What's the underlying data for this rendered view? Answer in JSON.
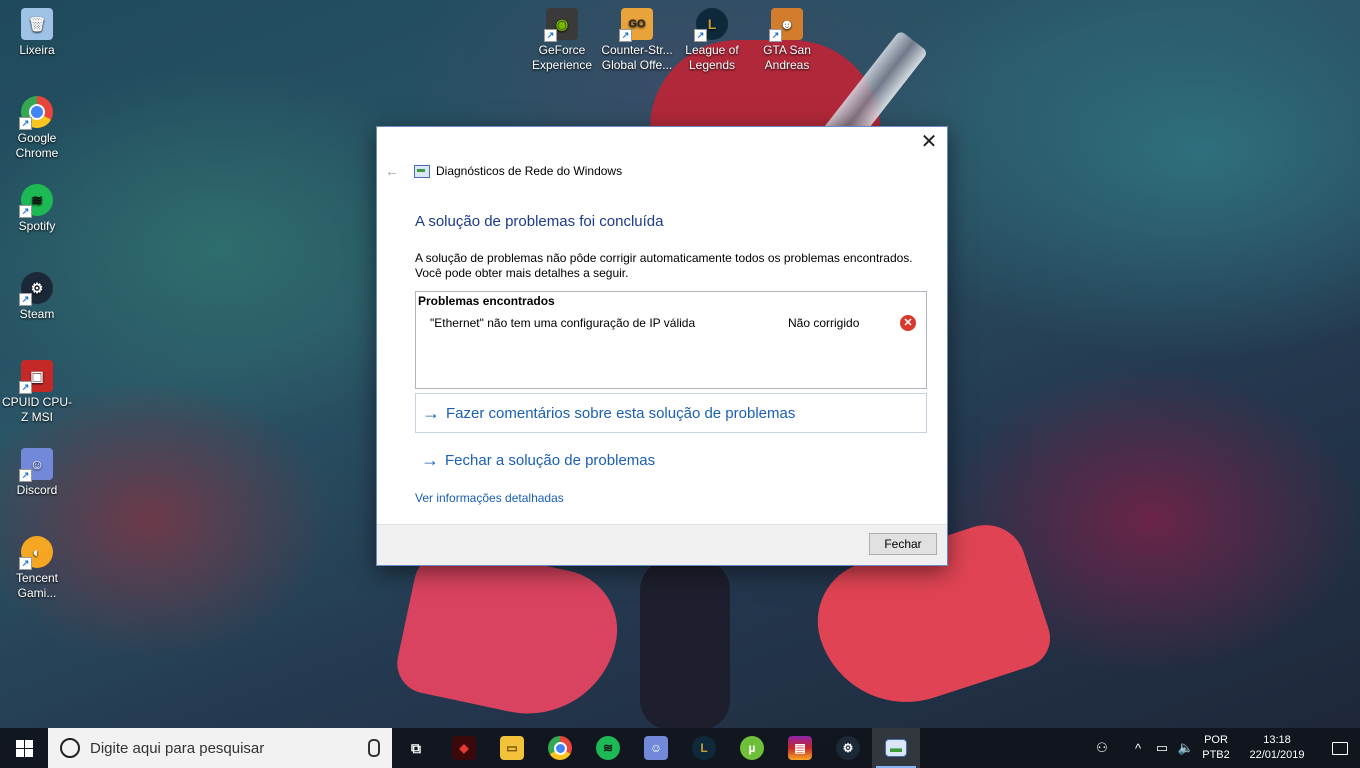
{
  "desktop": {
    "icons": [
      {
        "label": "Lixeira",
        "icon": "recycle-bin-icon",
        "color": "#8fb4d9"
      },
      {
        "label": "Google Chrome",
        "icon": "chrome-icon",
        "color": "#e8453c"
      },
      {
        "label": "Spotify",
        "icon": "spotify-icon",
        "color": "#1db954"
      },
      {
        "label": "Steam",
        "icon": "steam-icon",
        "color": "#1b2838"
      },
      {
        "label": "CPUID CPU-Z MSI",
        "icon": "cpuz-icon",
        "color": "#c62828"
      },
      {
        "label": "Discord",
        "icon": "discord-icon",
        "color": "#7289da"
      },
      {
        "label": "Tencent Gami...",
        "icon": "tencent-gaming-icon",
        "color": "#f5a623"
      },
      {
        "label": "GeForce Experience",
        "icon": "geforce-icon",
        "color": "#333333"
      },
      {
        "label": "Counter-Str... Global Offe...",
        "icon": "csgo-icon",
        "color": "#e8a33a"
      },
      {
        "label": "League of Legends",
        "icon": "league-icon",
        "color": "#c89b3c"
      },
      {
        "label": "GTA San Andreas",
        "icon": "gta-sa-icon",
        "color": "#d27d2d"
      }
    ]
  },
  "dialog": {
    "app_title": "Diagnósticos de Rede do Windows",
    "heading": "A solução de problemas foi concluída",
    "description_line1": "A solução de problemas não pôde corrigir automaticamente todos os problemas encontrados.",
    "description_line2": "Você pode obter mais detalhes a seguir.",
    "problems_title": "Problemas encontrados",
    "problem": {
      "text": "\"Ethernet\" não tem uma configuração de IP válida",
      "status": "Não corrigido"
    },
    "command_feedback": "Fazer comentários sobre esta solução de problemas",
    "command_close": "Fechar a solução de problemas",
    "details_link": "Ver informações detalhadas",
    "close_button": "Fechar",
    "accent_color": "#1a5fb4",
    "heading_color": "#1c3a8c"
  },
  "taskbar": {
    "search_placeholder": "Digite aqui para pesquisar",
    "pinned": [
      {
        "icon": "task-view-icon"
      },
      {
        "icon": "msi-dragon-icon"
      },
      {
        "icon": "file-explorer-icon"
      },
      {
        "icon": "chrome-icon"
      },
      {
        "icon": "spotify-icon"
      },
      {
        "icon": "discord-icon"
      },
      {
        "icon": "league-icon"
      },
      {
        "icon": "utorrent-icon"
      },
      {
        "icon": "winrar-icon"
      },
      {
        "icon": "steam-icon"
      },
      {
        "icon": "network-diagnostics-icon"
      }
    ],
    "tray": {
      "language_line1": "POR",
      "language_line2": "PTB2",
      "time": "13:18",
      "date": "22/01/2019"
    }
  }
}
